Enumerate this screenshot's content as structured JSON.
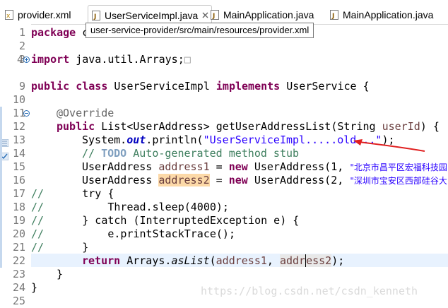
{
  "tabs": [
    {
      "label": "provider.xml",
      "icon": "xml-file-icon"
    },
    {
      "label": "UserServiceImpl.java",
      "icon": "java-file-icon",
      "active": true
    },
    {
      "label": "MainApplication.java",
      "icon": "java-file-icon"
    },
    {
      "label": "MainApplication.java",
      "icon": "java-file-icon"
    }
  ],
  "tooltip": "user-service-provider/src/main/resources/provider.xml",
  "watermark": "https://blog.csdn.net/csdn_kenneth",
  "lines": [
    {
      "n": "1"
    },
    {
      "n": "2"
    },
    {
      "n": "3"
    },
    {
      "n": "4"
    },
    {
      "n": "9"
    },
    {
      "n": "10"
    },
    {
      "n": "11"
    },
    {
      "n": "12"
    },
    {
      "n": "13"
    },
    {
      "n": "14"
    },
    {
      "n": "15"
    },
    {
      "n": "16"
    },
    {
      "n": "17"
    },
    {
      "n": "18"
    },
    {
      "n": "19"
    },
    {
      "n": "20"
    },
    {
      "n": "21"
    },
    {
      "n": "22"
    },
    {
      "n": "23"
    },
    {
      "n": "24"
    },
    {
      "n": "25"
    }
  ],
  "code": {
    "l1": {
      "kw": "package",
      "rest": " c"
    },
    "l4": {
      "kw": "import",
      "rest": " java.util.Arrays;",
      "box": "□"
    },
    "l10": {
      "kw1": "public",
      "kw2": "class",
      "name": " UserServiceImpl ",
      "kw3": "implements",
      "rest": " UserService {"
    },
    "l12": {
      "ann": "@Override"
    },
    "l13": {
      "kw": "public",
      "t1": " List<UserAddress> getUserAddressList(String ",
      "param": "userId",
      "t2": ") {"
    },
    "l14": {
      "t1": "System.",
      "field": "out",
      "t2": ".println(",
      "str": "\"UserServiceImpl.....old...\"",
      "t3": ");"
    },
    "l15": {
      "c1": "// ",
      "todo": "TODO",
      "c2": " Auto-generated method stub"
    },
    "l16": {
      "t1": "UserAddress ",
      "var": "address1",
      "t2": " = ",
      "kw": "new",
      "t3": " UserAddress(1, ",
      "str": "\"北京市昌平区宏福科技园"
    },
    "l17": {
      "t1": "UserAddress ",
      "var": "address2",
      "t2": " = ",
      "kw": "new",
      "t3": " UserAddress(2, ",
      "str": "\"深圳市宝安区西部硅谷大"
    },
    "l18": {
      "cm": "//",
      "t": "      try {"
    },
    "l19": {
      "cm": "//",
      "t": "          Thread.sleep(4000);"
    },
    "l20": {
      "cm": "//",
      "t": "      } catch (InterruptedException e) {"
    },
    "l21": {
      "cm": "//",
      "t": "          e.printStackTrace();"
    },
    "l22": {
      "cm": "//",
      "t": "      }"
    },
    "l23": {
      "kw": "return",
      "t1": " Arrays.",
      "it": "asList",
      "t2": "(",
      "v1": "address1",
      "t3": ", ",
      "v2a": "addr",
      "v2b": "ess2",
      "t4": ");"
    },
    "l24": {
      "t": "}"
    },
    "l25": {
      "t": "}"
    }
  }
}
